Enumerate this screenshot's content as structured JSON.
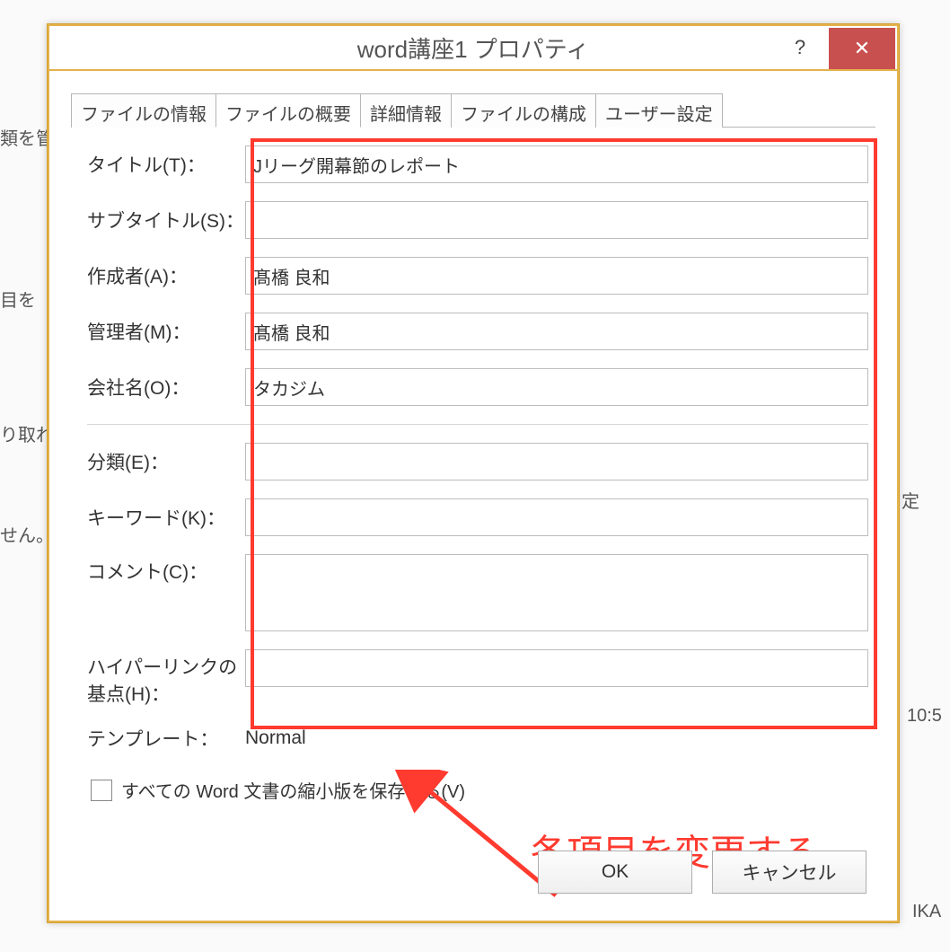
{
  "background_fragments": {
    "f1": "類を管",
    "f2": "目を",
    "f3": "り取れ",
    "f4": "定",
    "f5": "せん。",
    "f6": "10:5",
    "f7": "IKA"
  },
  "dialog": {
    "title": "word講座1 プロパティ",
    "help": "?",
    "close": "✕"
  },
  "tabs": [
    {
      "label": "ファイルの情報",
      "active": false
    },
    {
      "label": "ファイルの概要",
      "active": true
    },
    {
      "label": "詳細情報",
      "active": false
    },
    {
      "label": "ファイルの構成",
      "active": false
    },
    {
      "label": "ユーザー設定",
      "active": false
    }
  ],
  "form": {
    "title_label": "タイトル(T)：",
    "title_value": "Jリーグ開幕節のレポート",
    "subtitle_label": "サブタイトル(S)：",
    "subtitle_value": "",
    "author_label": "作成者(A)：",
    "author_value": "髙橋 良和",
    "manager_label": "管理者(M)：",
    "manager_value": "髙橋 良和",
    "company_label": "会社名(O)：",
    "company_value": "タカジム",
    "category_label": "分類(E)：",
    "category_value": "",
    "keywords_label": "キーワード(K)：",
    "keywords_value": "",
    "comments_label": "コメント(C)：",
    "comments_value": "",
    "hyperlink_label1": "ハイパーリンクの",
    "hyperlink_label2": "基点(H)：",
    "hyperlink_value": "",
    "template_label": "テンプレート：",
    "template_value": "Normal",
    "save_thumb_label": "すべての Word 文書の縮小版を保存する(V)"
  },
  "annotation": "各項目を変更する",
  "buttons": {
    "ok": "OK",
    "cancel": "キャンセル"
  }
}
